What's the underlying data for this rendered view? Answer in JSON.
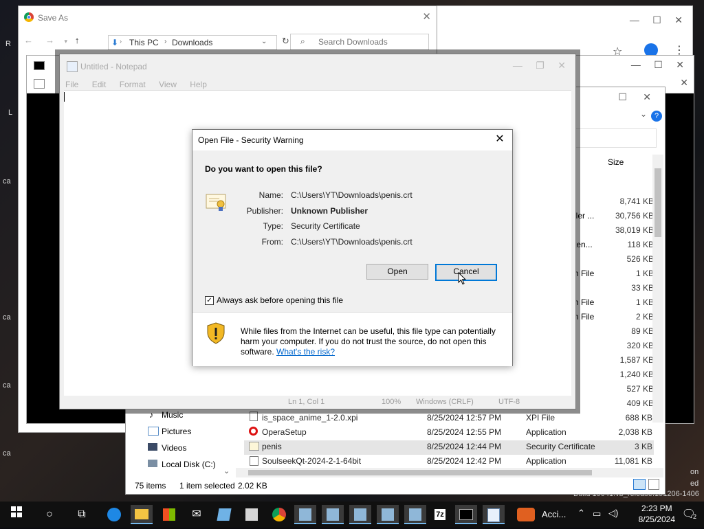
{
  "save_as": {
    "title": "Save As",
    "breadcrumb": [
      "This PC",
      "Downloads"
    ],
    "search_placeholder": "Search Downloads"
  },
  "notepad": {
    "title": "Untitled - Notepad",
    "menu": [
      "File",
      "Edit",
      "Format",
      "View",
      "Help"
    ],
    "status": {
      "position": "Ln 1, Col 1",
      "zoom": "100%",
      "line_ending": "Windows (CRLF)",
      "encoding": "UTF-8"
    }
  },
  "dialog": {
    "title": "Open File - Security Warning",
    "question": "Do you want to open this file?",
    "fields": [
      {
        "label": "Name:",
        "value": "C:\\Users\\YT\\Downloads\\penis.crt",
        "bold": false
      },
      {
        "label": "Publisher:",
        "value": "Unknown Publisher",
        "bold": true
      },
      {
        "label": "Type:",
        "value": "Security Certificate",
        "bold": false
      },
      {
        "label": "From:",
        "value": "C:\\Users\\YT\\Downloads\\penis.crt",
        "bold": false
      }
    ],
    "open_label": "Open",
    "cancel_label": "Cancel",
    "checkbox_label": "Always ask before opening this file",
    "warning_text": "While files from the Internet can be useful, this file type can potentially harm your computer. If you do not trust the source, do not open this software.",
    "warning_link": "What's the risk?"
  },
  "explorer": {
    "size_header": "Size",
    "sidebar": [
      "Music",
      "Pictures",
      "Videos",
      "Local Disk (C:)"
    ],
    "sizes_upper": [
      "8,741 KB",
      "30,756 KB",
      "38,019 KB",
      "118 KB",
      "526 KB",
      "1 KB",
      "33 KB",
      "1 KB",
      "2 KB",
      "89 KB",
      "320 KB",
      "1,587 KB",
      "1,240 KB",
      "527 KB",
      "409 KB"
    ],
    "type_fragments": [
      "ller ...",
      "ten...",
      "n File",
      "n File",
      "n File"
    ],
    "rows": [
      {
        "name": "is_space_anime_1-2.0.xpi",
        "date": "8/25/2024 12:57 PM",
        "type": "XPI File",
        "size": "688 KB"
      },
      {
        "name": "OperaSetup",
        "date": "8/25/2024 12:55 PM",
        "type": "Application",
        "size": "2,038 KB"
      },
      {
        "name": "penis",
        "date": "8/25/2024 12:44 PM",
        "type": "Security Certificate",
        "size": "3 KB"
      },
      {
        "name": "SoulseekQt-2024-2-1-64bit",
        "date": "8/25/2024 12:42 PM",
        "type": "Application",
        "size": "11,081 KB"
      }
    ],
    "status": {
      "items": "75 items",
      "selected": "1 item selected",
      "size": "2.02 KB"
    }
  },
  "desktop": {
    "build_text": "Build 19041.vb_release.191206-1406",
    "side_labels": [
      "R",
      "L",
      "ca",
      "ca",
      "ca",
      "ca"
    ],
    "right_labels": [
      "on",
      "ed"
    ]
  },
  "taskbar": {
    "time": "2:23 PM",
    "date": "8/25/2024",
    "accident_label": "Acci...",
    "notification_count": "2"
  }
}
